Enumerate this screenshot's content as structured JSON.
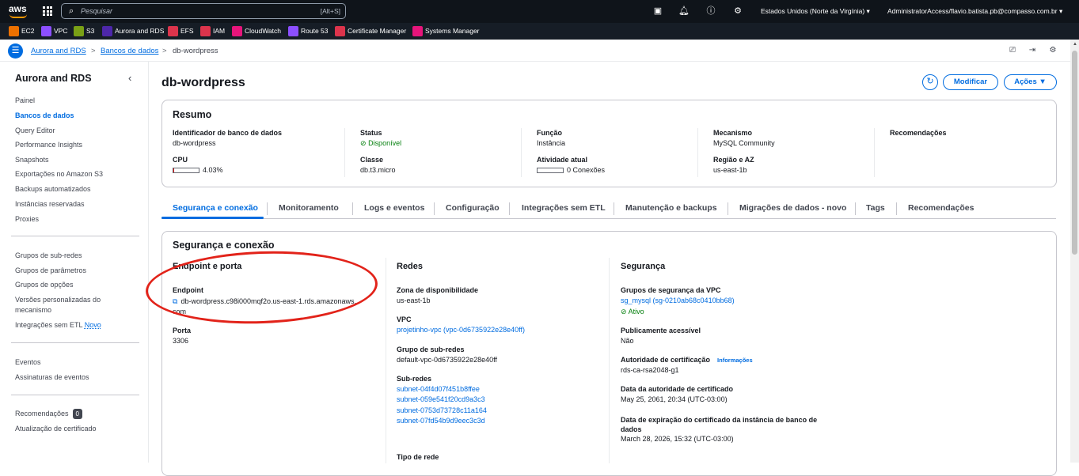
{
  "topbar": {
    "logo": "aws",
    "search_placeholder": "Pesquisar",
    "search_shortcut": "[Alt+S]",
    "region": "Estados Unidos (Norte da Virgínia) ▾",
    "user": "AdministratorAccess/flavio.batista.pb@compasso.com.br ▾",
    "icons": [
      "cloudshell-icon",
      "bell-icon",
      "help-icon",
      "gear-icon"
    ]
  },
  "favorites": [
    {
      "label": "EC2",
      "color": "#ed7100"
    },
    {
      "label": "VPC",
      "color": "#8c4fff"
    },
    {
      "label": "S3",
      "color": "#7aa116"
    },
    {
      "label": "Aurora and RDS",
      "color": "#4d27aa"
    },
    {
      "label": "EFS",
      "color": "#dd344c"
    },
    {
      "label": "IAM",
      "color": "#dd344c"
    },
    {
      "label": "CloudWatch",
      "color": "#e7157b"
    },
    {
      "label": "Route 53",
      "color": "#8c4fff"
    },
    {
      "label": "Certificate Manager",
      "color": "#dd344c"
    },
    {
      "label": "Systems Manager",
      "color": "#e7157b"
    }
  ],
  "breadcrumb": {
    "items": [
      "Aurora and RDS",
      "Bancos de dados",
      "db-wordpress"
    ],
    "sep": ">"
  },
  "sidebar": {
    "title": "Aurora and RDS",
    "group1": [
      "Painel",
      "Bancos de dados",
      "Query Editor",
      "Performance Insights",
      "Snapshots",
      "Exportações no Amazon S3",
      "Backups automatizados",
      "Instâncias reservadas",
      "Proxies"
    ],
    "group2": [
      "Grupos de sub-redes",
      "Grupos de parâmetros",
      "Grupos de opções",
      "Versões personalizadas do mecanismo",
      "Integrações sem ETL"
    ],
    "novo": "Novo",
    "group3": [
      "Eventos",
      "Assinaturas de eventos"
    ],
    "group4": [
      "Recomendações",
      "Atualização de certificado"
    ],
    "rec_count": "0"
  },
  "page": {
    "title": "db-wordpress",
    "modify": "Modificar",
    "actions": "Ações ▼"
  },
  "summary": {
    "title": "Resumo",
    "id_label": "Identificador de banco de dados",
    "id_value": "db-wordpress",
    "cpu_label": "CPU",
    "cpu_value": "4.03%",
    "cpu_fraction": 0.0403,
    "status_label": "Status",
    "status_value": "Disponível",
    "class_label": "Classe",
    "class_value": "db.t3.micro",
    "role_label": "Função",
    "role_value": "Instância",
    "activity_label": "Atividade atual",
    "activity_value": "0 Conexões",
    "engine_label": "Mecanismo",
    "engine_value": "MySQL Community",
    "region_label": "Região e AZ",
    "region_value": "us-east-1b",
    "rec_label": "Recomendações"
  },
  "tabs": [
    "Segurança e conexão",
    "Monitoramento",
    "Logs e eventos",
    "Configuração",
    "Integrações sem ETL",
    "Manutenção e backups",
    "Migrações de dados - novo",
    "Tags",
    "Recomendações"
  ],
  "conn": {
    "title": "Segurança e conexão",
    "endpoint_section": "Endpoint e porta",
    "endpoint_label": "Endpoint",
    "endpoint_value_1": "db-wordpress.c98i000mqf2o.us-east-1.rds.amazonaws.",
    "endpoint_value_2": "com",
    "port_label": "Porta",
    "port_value": "3306",
    "net_section": "Redes",
    "az_label": "Zona de disponibilidade",
    "az_value": "us-east-1b",
    "vpc_label": "VPC",
    "vpc_value": "projetinho-vpc (vpc-0d6735922e28e40ff)",
    "subnetgrp_label": "Grupo de sub-redes",
    "subnetgrp_value": "default-vpc-0d6735922e28e40ff",
    "subnets_label": "Sub-redes",
    "subnets": [
      "subnet-04f4d07f451b8ffee",
      "subnet-059e541f20cd9a3c3",
      "subnet-0753d73728c11a164",
      "subnet-07fd54b9d9eec3c3d"
    ],
    "nettype_label": "Tipo de rede",
    "sec_section": "Segurança",
    "sg_label": "Grupos de segurança da VPC",
    "sg_value": "sg_mysql (sg-0210ab68c0410bb68)",
    "sg_status": "Ativo",
    "public_label": "Publicamente acessível",
    "public_value": "Não",
    "ca_label": "Autoridade de certificação",
    "ca_info": "Informações",
    "ca_value": "rds-ca-rsa2048-g1",
    "ca_date_label": "Data da autoridade de certificado",
    "ca_date_value": "May 25, 2061, 20:34 (UTC-03:00)",
    "exp_label": "Data de expiração do certificado da instância de banco de dados",
    "exp_value": "March 28, 2026, 15:32 (UTC-03:00)"
  }
}
